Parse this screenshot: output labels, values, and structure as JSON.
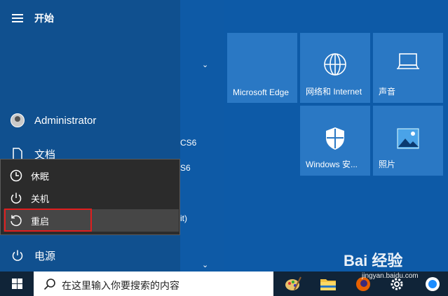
{
  "start": {
    "title": "开始",
    "user": "Administrator",
    "documents": "文档",
    "power": "电源"
  },
  "power_menu": {
    "sleep": "休眠",
    "shutdown": "关机",
    "restart": "重启"
  },
  "app_list": {
    "partial_1": "CS6",
    "partial_2": "S6",
    "partial_3": "it)"
  },
  "tiles": {
    "edge": "Microsoft Edge",
    "network": "网络和 Internet",
    "sound": "声音",
    "security": "Windows 安...",
    "photos": "照片"
  },
  "taskbar": {
    "search_placeholder": "在这里输入你要搜索的内容"
  },
  "watermark": {
    "brand": "Bai 经验",
    "url": "jingyan.baidu.com"
  },
  "colors": {
    "accent": "#2a78c4",
    "highlight": "#e01e1e"
  }
}
